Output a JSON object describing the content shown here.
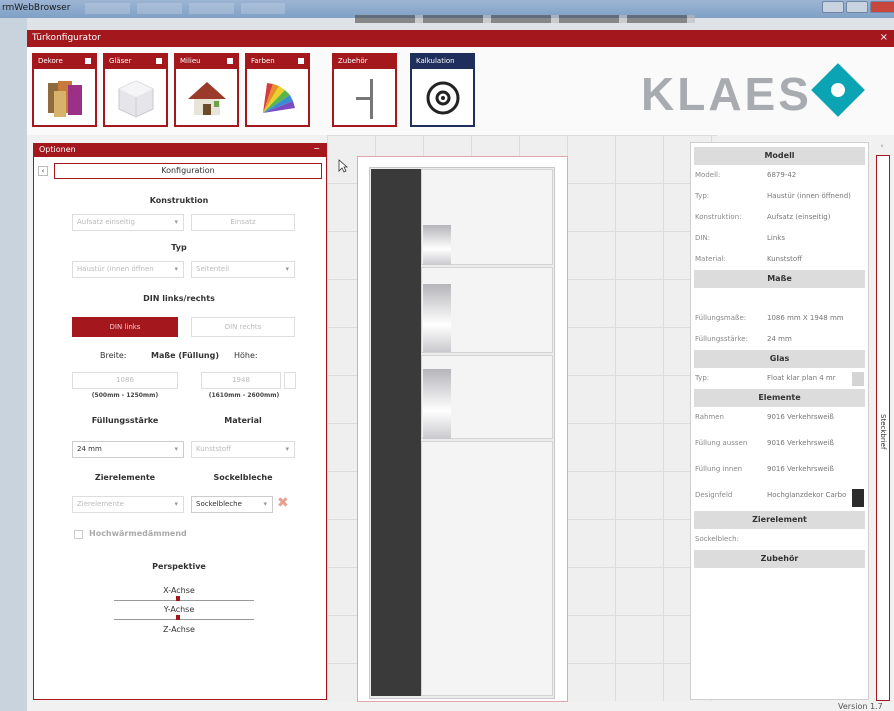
{
  "os": {
    "title": "rmWebBrowser"
  },
  "app": {
    "title": "Türkonfigurator",
    "close": "×"
  },
  "toolbar": {
    "tiles": [
      {
        "label": "Dekore"
      },
      {
        "label": "Gläser"
      },
      {
        "label": "Milieu"
      },
      {
        "label": "Farben"
      },
      {
        "label": "Zubehör"
      },
      {
        "label": "Kalkulation"
      }
    ],
    "logo": "KLAES",
    "colors": {
      "brand_red": "#a3171d",
      "navy": "#1f2e5a",
      "teal": "#0ba4b4"
    }
  },
  "options": {
    "header": "Optionen",
    "minimize": "−",
    "konfiguration": "Konfiguration",
    "konstruktion": {
      "title": "Konstruktion",
      "select": "Aufsatz einseitig",
      "button": "Einsatz"
    },
    "typ": {
      "title": "Typ",
      "select": "Haustür (innen öffnen",
      "select2": "Seitenteil"
    },
    "din": {
      "title": "DIN links/rechts",
      "left": "DIN links",
      "right": "DIN rechts"
    },
    "masse": {
      "breite": "Breite:",
      "title": "Maße (Füllung)",
      "hoehe": "Höhe:",
      "breite_val": "1086",
      "hoehe_val": "1948",
      "breite_range": "(500mm - 1250mm)",
      "hoehe_range": "(1610mm - 2600mm)"
    },
    "fuellungsstaerke": {
      "title": "Füllungsstärke",
      "value": "24 mm"
    },
    "material": {
      "title": "Material",
      "value": "Kunststoff"
    },
    "zierelemente": {
      "title": "Zierelemente",
      "value": "Zierelemente"
    },
    "sockelbleche": {
      "title": "Sockelbleche",
      "value": "Sockelbleche"
    },
    "hochwaerme": "Hochwärmedämmend",
    "perspektive": {
      "title": "Perspektive",
      "x": "X-Achse",
      "y": "Y-Achse",
      "z": "Z-Achse"
    }
  },
  "props": {
    "sections": {
      "modell": "Modell",
      "masse": "Maße",
      "glas": "Glas",
      "elemente": "Elemente",
      "zierelement": "Zierelement",
      "zubehoer": "Zubehör"
    },
    "modell_rows": [
      {
        "k": "Modell:",
        "v": "6879-42"
      },
      {
        "k": "Typ:",
        "v": "Haustür (innen öffnend)"
      },
      {
        "k": "Konstruktion:",
        "v": "Aufsatz (einseitig)"
      },
      {
        "k": "DIN:",
        "v": "Links"
      },
      {
        "k": "Material:",
        "v": "Kunststoff"
      }
    ],
    "masse_rows": [
      {
        "k": "Füllungsmaße:",
        "v": "1086 mm X 1948 mm"
      },
      {
        "k": "Füllungsstärke:",
        "v": "24 mm"
      }
    ],
    "glas_rows": [
      {
        "k": "Typ:",
        "v": "Float klar plan 4 mr"
      }
    ],
    "elemente_rows": [
      {
        "k": "Rahmen",
        "v": "9016 Verkehrsweiß"
      },
      {
        "k": "Füllung aussen",
        "v": "9016 Verkehrsweiß"
      },
      {
        "k": "Füllung innen",
        "v": "9016 Verkehrsweiß"
      },
      {
        "k": "Designfeld",
        "v": "Hochglanzdekor Carbo"
      }
    ],
    "zier_rows": [
      {
        "k": "Sockelblech:",
        "v": ""
      }
    ],
    "side_tab": "Steckbrief"
  },
  "version": "Version 1.7"
}
